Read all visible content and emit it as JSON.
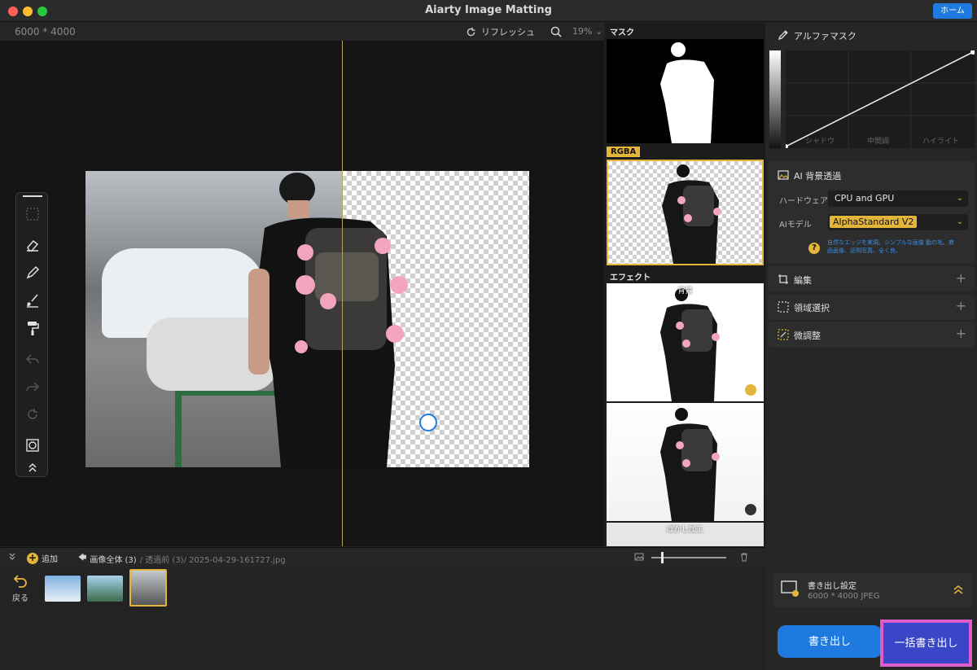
{
  "app": {
    "title": "Aiarty Image Matting",
    "home_label": "ホーム"
  },
  "toolbar": {
    "dimensions": "6000 * 4000",
    "refresh_label": "リフレッシュ",
    "zoom": "19%"
  },
  "previews": {
    "mask_label": "マスク",
    "rgba_label": "RGBA",
    "effect_label": "エフェクト",
    "effect_item1": "背景",
    "effect_item2": "ぼかし加工"
  },
  "bottom_bar": {
    "add_label": "追加",
    "breadcrumb_all": "画像全体 (3)",
    "breadcrumb_path": "/ 透過前 (3)/ 2025-04-29-161727.jpg",
    "back_label": "戻る"
  },
  "right_panel": {
    "alpha_mask_title": "アルファマスク",
    "curve_labels": [
      "シャドウ",
      "中間調",
      "ハイライト"
    ],
    "ai_bg_title": "AI 背景透過",
    "hardware_label": "ハードウェア",
    "hardware_value": "CPU and GPU",
    "ai_model_label": "AIモデル",
    "ai_model_value": "AlphaStandard  V2",
    "ai_model_hint": "自然なエッジを実現。シンプルな画像 動の毛、商品画像、証明写真、全く良。",
    "edit_title": "編集",
    "region_title": "領域選択",
    "fine_tune_title": "微調整",
    "export_settings_title": "書き出し設定",
    "export_settings_value": "6000 * 4000  JPEG",
    "export_label": "書き出し",
    "batch_export_label": "一括書き出し"
  },
  "colors": {
    "accent_blue": "#1f7ae0",
    "accent_gold": "#e3b53a",
    "highlight_pink": "#e05cc9"
  }
}
